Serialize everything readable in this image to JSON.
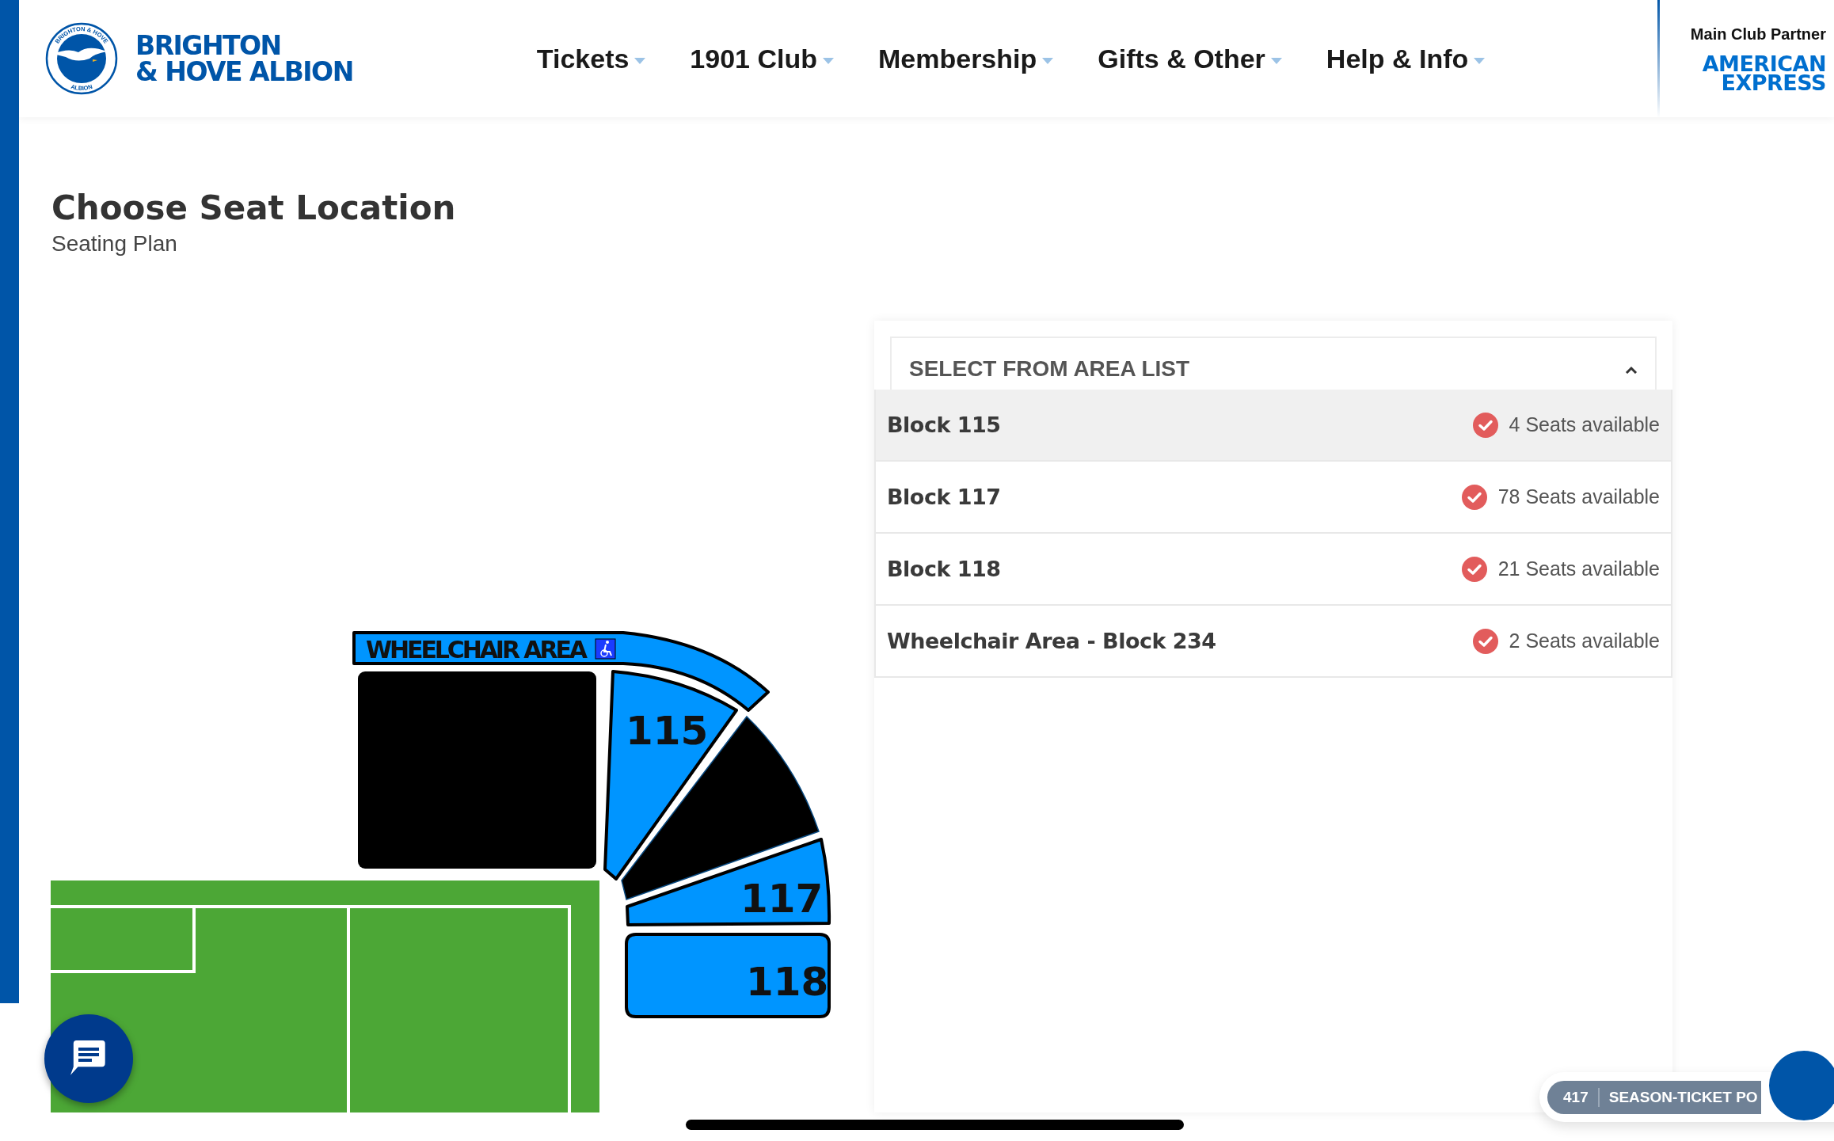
{
  "header": {
    "crest": {
      "top": "BRIGHTON & HOVE",
      "bottom": "ALBION"
    },
    "wordmark": [
      "BRIGHTON",
      "& HOVE ALBION"
    ],
    "nav": [
      {
        "label": "Tickets"
      },
      {
        "label": "1901 Club"
      },
      {
        "label": "Membership"
      },
      {
        "label": "Gifts & Other"
      },
      {
        "label": "Help & Info"
      }
    ],
    "partner": {
      "label": "Main Club Partner",
      "logo": [
        "AMERICAN",
        "EXPRESS"
      ]
    }
  },
  "page": {
    "title": "Choose Seat Location",
    "subtitle": "Seating Plan"
  },
  "seating_map": {
    "wheelchair_label": "WHEELCHAIR AREA",
    "blocks": [
      {
        "label": "115"
      },
      {
        "label": "117"
      },
      {
        "label": "118"
      }
    ]
  },
  "area_list": {
    "header": "SELECT FROM AREA LIST",
    "expanded": true,
    "items": [
      {
        "name": "Block 115",
        "availability": "4 Seats available",
        "selected": true
      },
      {
        "name": "Block 117",
        "availability": "78 Seats available",
        "selected": false
      },
      {
        "name": "Block 118",
        "availability": "21 Seats available",
        "selected": false
      },
      {
        "name": "Wheelchair Area - Block 234",
        "availability": "2 Seats available",
        "selected": false
      }
    ]
  },
  "season_ticket": {
    "number": "417",
    "label": "SEASON-TICKET PO"
  }
}
